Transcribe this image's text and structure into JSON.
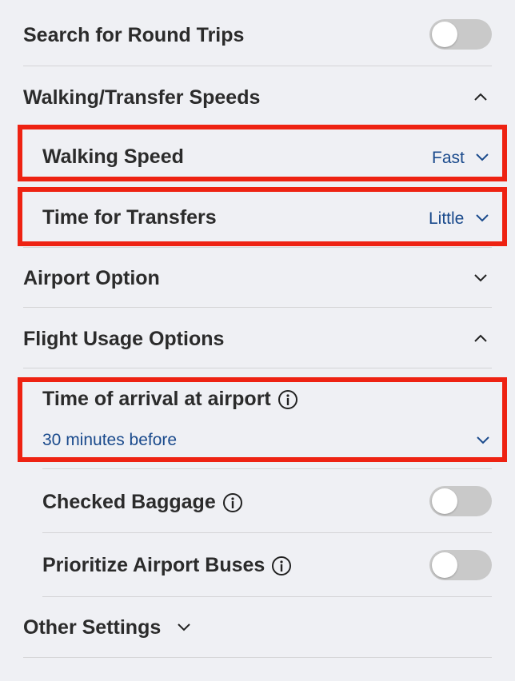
{
  "settings": {
    "round_trips": {
      "label": "Search for Round Trips",
      "enabled": false
    },
    "walking_transfer": {
      "label": "Walking/Transfer Speeds",
      "state": "expanded"
    },
    "walking_speed": {
      "label": "Walking Speed",
      "value": "Fast"
    },
    "transfer_time": {
      "label": "Time for Transfers",
      "value": "Little"
    },
    "airport_option": {
      "label": "Airport Option",
      "state": "collapsed"
    },
    "flight_usage": {
      "label": "Flight Usage Options",
      "state": "expanded"
    },
    "arrival_time": {
      "label": "Time of arrival at airport",
      "value": "30 minutes before"
    },
    "checked_baggage": {
      "label": "Checked Baggage",
      "enabled": false
    },
    "airport_buses": {
      "label": "Prioritize Airport Buses",
      "enabled": false
    },
    "other_settings": {
      "label": "Other Settings",
      "state": "collapsed"
    }
  },
  "colors": {
    "highlight": "#ee2212",
    "value_text": "#1a4a8c",
    "toggle_off": "#c9c9c9"
  },
  "icons": {
    "chevron_up": "chevron-up-icon",
    "chevron_down": "chevron-down-icon",
    "info": "info-icon"
  }
}
